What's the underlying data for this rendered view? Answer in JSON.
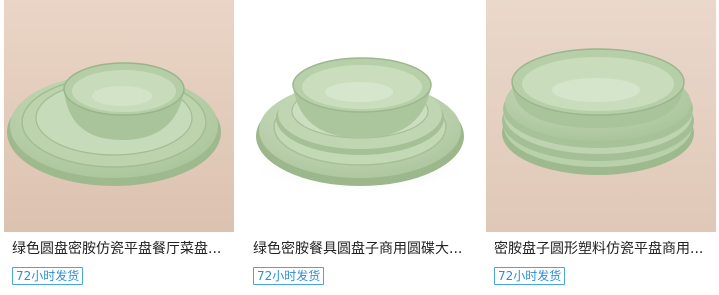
{
  "products": [
    {
      "title": "绿色圆盘密胺仿瓷平盘餐厅菜盘...",
      "badge": "72小时发货",
      "image": "green-melamine-bowl-and-plates-set"
    },
    {
      "title": "绿色密胺餐具圆盘子商用圆碟大...",
      "badge": "72小时发货",
      "image": "green-melamine-bowl-on-two-plates"
    },
    {
      "title": "密胺盘子圆形塑料仿瓷平盘商用...",
      "badge": "72小时发货",
      "image": "green-melamine-deep-plate-stack"
    }
  ],
  "colors": {
    "accent": "#2b8fd6",
    "product_green": "#b6cfa8",
    "backdrop_beige": "#e4cdbd"
  }
}
